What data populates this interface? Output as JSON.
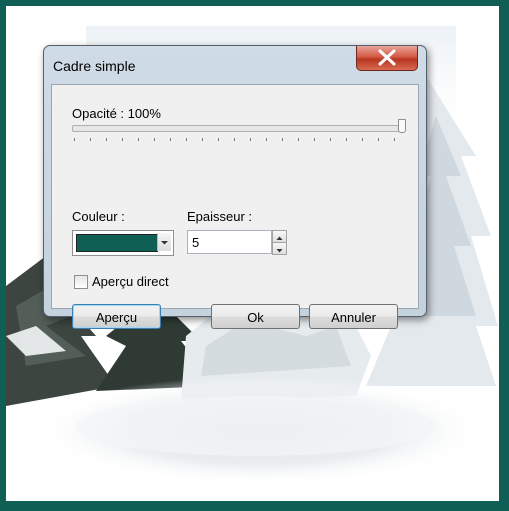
{
  "window": {
    "title": "Cadre simple",
    "close_icon": "close-icon"
  },
  "opacity": {
    "label": "Opacité : 100%",
    "value": 1.0
  },
  "color": {
    "label": "Couleur :",
    "value": "#0f5f55"
  },
  "thickness": {
    "label": "Epaisseur :",
    "value": "5"
  },
  "preview_direct": {
    "label": "Aperçu direct",
    "checked": false
  },
  "buttons": {
    "preview": "Aperçu",
    "ok": "Ok",
    "cancel": "Annuler"
  },
  "frame_color": "#0f5f55"
}
